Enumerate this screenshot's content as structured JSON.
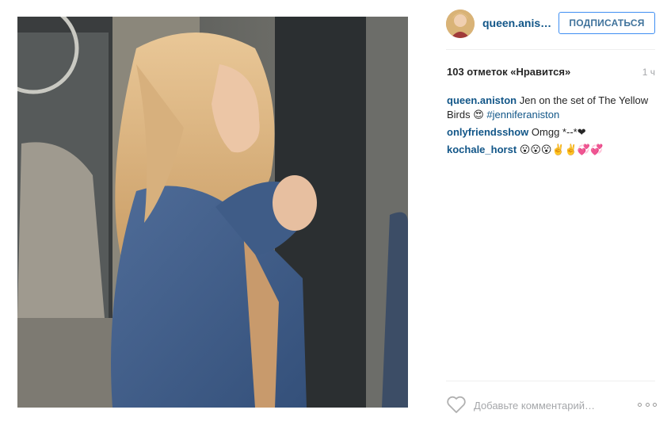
{
  "post": {
    "username": "queen.anis…",
    "follow_label": "ПОДПИСАТЬСЯ",
    "likes_text": "103 отметок «Нравится»",
    "time_ago": "1 ч"
  },
  "comments": [
    {
      "user": "queen.aniston",
      "text": "Jen on the set of The Yellow Birds 😍",
      "hashtag": "#jenniferaniston"
    },
    {
      "user": "onlyfriendsshow",
      "text": "Omgg *--*❤"
    },
    {
      "user": "kochale_horst",
      "text": "😮😮😮✌️✌️💞💞"
    }
  ],
  "footer": {
    "comment_placeholder": "Добавьте комментарий…"
  },
  "icons": {
    "like": "heart-outline-icon",
    "options": "more-options-icon"
  },
  "colors": {
    "username_blue": "#125688",
    "follow_border": "#3f8ef2",
    "muted_text": "#a5a7aa"
  }
}
